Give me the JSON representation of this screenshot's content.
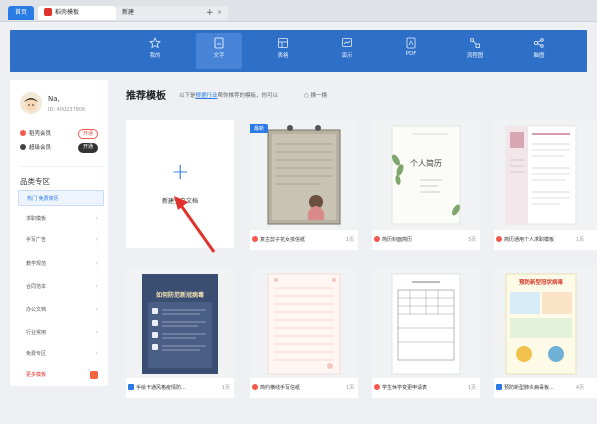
{
  "tabs": [
    {
      "label": "首页"
    },
    {
      "label": "稻壳模板"
    },
    {
      "label": "新建"
    }
  ],
  "tab_close": "×",
  "tab_add": "+",
  "modules": [
    {
      "label": "我的",
      "icon": "star-icon"
    },
    {
      "label": "文字",
      "icon": "document-icon",
      "active": true
    },
    {
      "label": "表格",
      "icon": "table-icon"
    },
    {
      "label": "演示",
      "icon": "presentation-icon"
    },
    {
      "label": "PDF",
      "icon": "pdf-icon"
    },
    {
      "label": "流程图",
      "icon": "flowchart-icon"
    },
    {
      "label": "脑图",
      "icon": "mindmap-icon"
    }
  ],
  "user": {
    "name": "Na,",
    "id": "ID: 400237806"
  },
  "memberships": [
    {
      "label": "稻壳会员",
      "button": "开通",
      "color": "#f25a4d"
    },
    {
      "label": "超级会员",
      "button": "开通",
      "color": "#444444"
    }
  ],
  "category_title": "品类专区",
  "categories": [
    {
      "label": "热门  免费简历",
      "selected": true
    },
    {
      "label": "求职模板"
    },
    {
      "label": "手写广告"
    },
    {
      "label": "教学规范"
    },
    {
      "label": "合同范本"
    },
    {
      "label": "办公文档"
    },
    {
      "label": "行业常用"
    },
    {
      "label": "免费专区"
    },
    {
      "label": "更多模板",
      "more": true
    }
  ],
  "main": {
    "title": "推荐模板",
    "hint_prefix": "以下是",
    "hint_link": "根据行业",
    "hint_suffix": "帮你推荐的模板，你可以",
    "refresh": "换一换",
    "new_doc_label": "新建空白文档",
    "new_badge": "最新"
  },
  "templates": [
    {
      "caption": "复古剪子花女孩信纸",
      "pages": "1页",
      "icon_color": "#f25a4d"
    },
    {
      "caption": "简历封面简历",
      "pages": "3页",
      "icon_color": "#f25a4d"
    },
    {
      "caption": "简历通用个人求职模板",
      "pages": "1页",
      "icon_color": "#f25a4d"
    },
    {
      "caption": "手绘卡通风格疫情防...",
      "pages": "1页",
      "icon_color": "#2b7be5"
    },
    {
      "caption": "简约横线手写信纸",
      "pages": "1页",
      "icon_color": "#f25a4d"
    },
    {
      "caption": "学生休学变更申请表",
      "pages": "1页",
      "icon_color": "#f25a4d"
    },
    {
      "caption": "预防新型肺炎病毒板...",
      "pages": "4页",
      "icon_color": "#2b7be5"
    }
  ],
  "thumb_text": {
    "resume_cn": "个人简历",
    "poster_title": "如何防范新冠病毒",
    "flyer_title": "预防新型冠状病毒"
  }
}
